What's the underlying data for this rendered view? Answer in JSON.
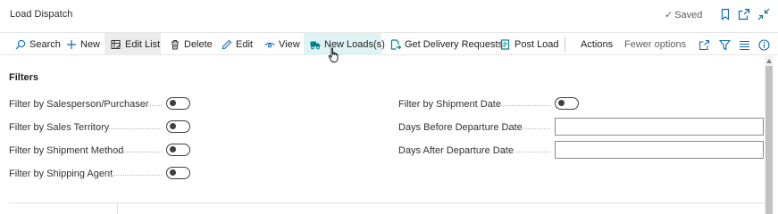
{
  "page": {
    "title": "Load Dispatch",
    "saved_label": "Saved"
  },
  "actions": {
    "search": "Search",
    "new": "New",
    "edit_list": "Edit List",
    "delete": "Delete",
    "edit": "Edit",
    "view": "View",
    "new_loads": "New Loads(s)",
    "get_delivery_requests": "Get Delivery Requests",
    "post_load": "Post Load",
    "actions_menu": "Actions",
    "fewer_options": "Fewer options"
  },
  "filters": {
    "section_title": "Filters",
    "left": [
      {
        "label": "Filter by Salesperson/Purchaser",
        "enabled": false
      },
      {
        "label": "Filter by Sales Territory",
        "enabled": false
      },
      {
        "label": "Filter by Shipment Method",
        "enabled": false
      },
      {
        "label": "Filter by Shipping Agent",
        "enabled": false
      }
    ],
    "right": [
      {
        "label": "Filter by Shipment Date",
        "type": "toggle",
        "enabled": false
      },
      {
        "label": "Days Before Departure Date",
        "type": "text",
        "value": ""
      },
      {
        "label": "Days After Departure Date",
        "type": "text",
        "value": ""
      }
    ]
  },
  "colors": {
    "accent_hover": "#dff3f5",
    "selected_bg": "#ececec",
    "icon_teal": "#008489"
  }
}
